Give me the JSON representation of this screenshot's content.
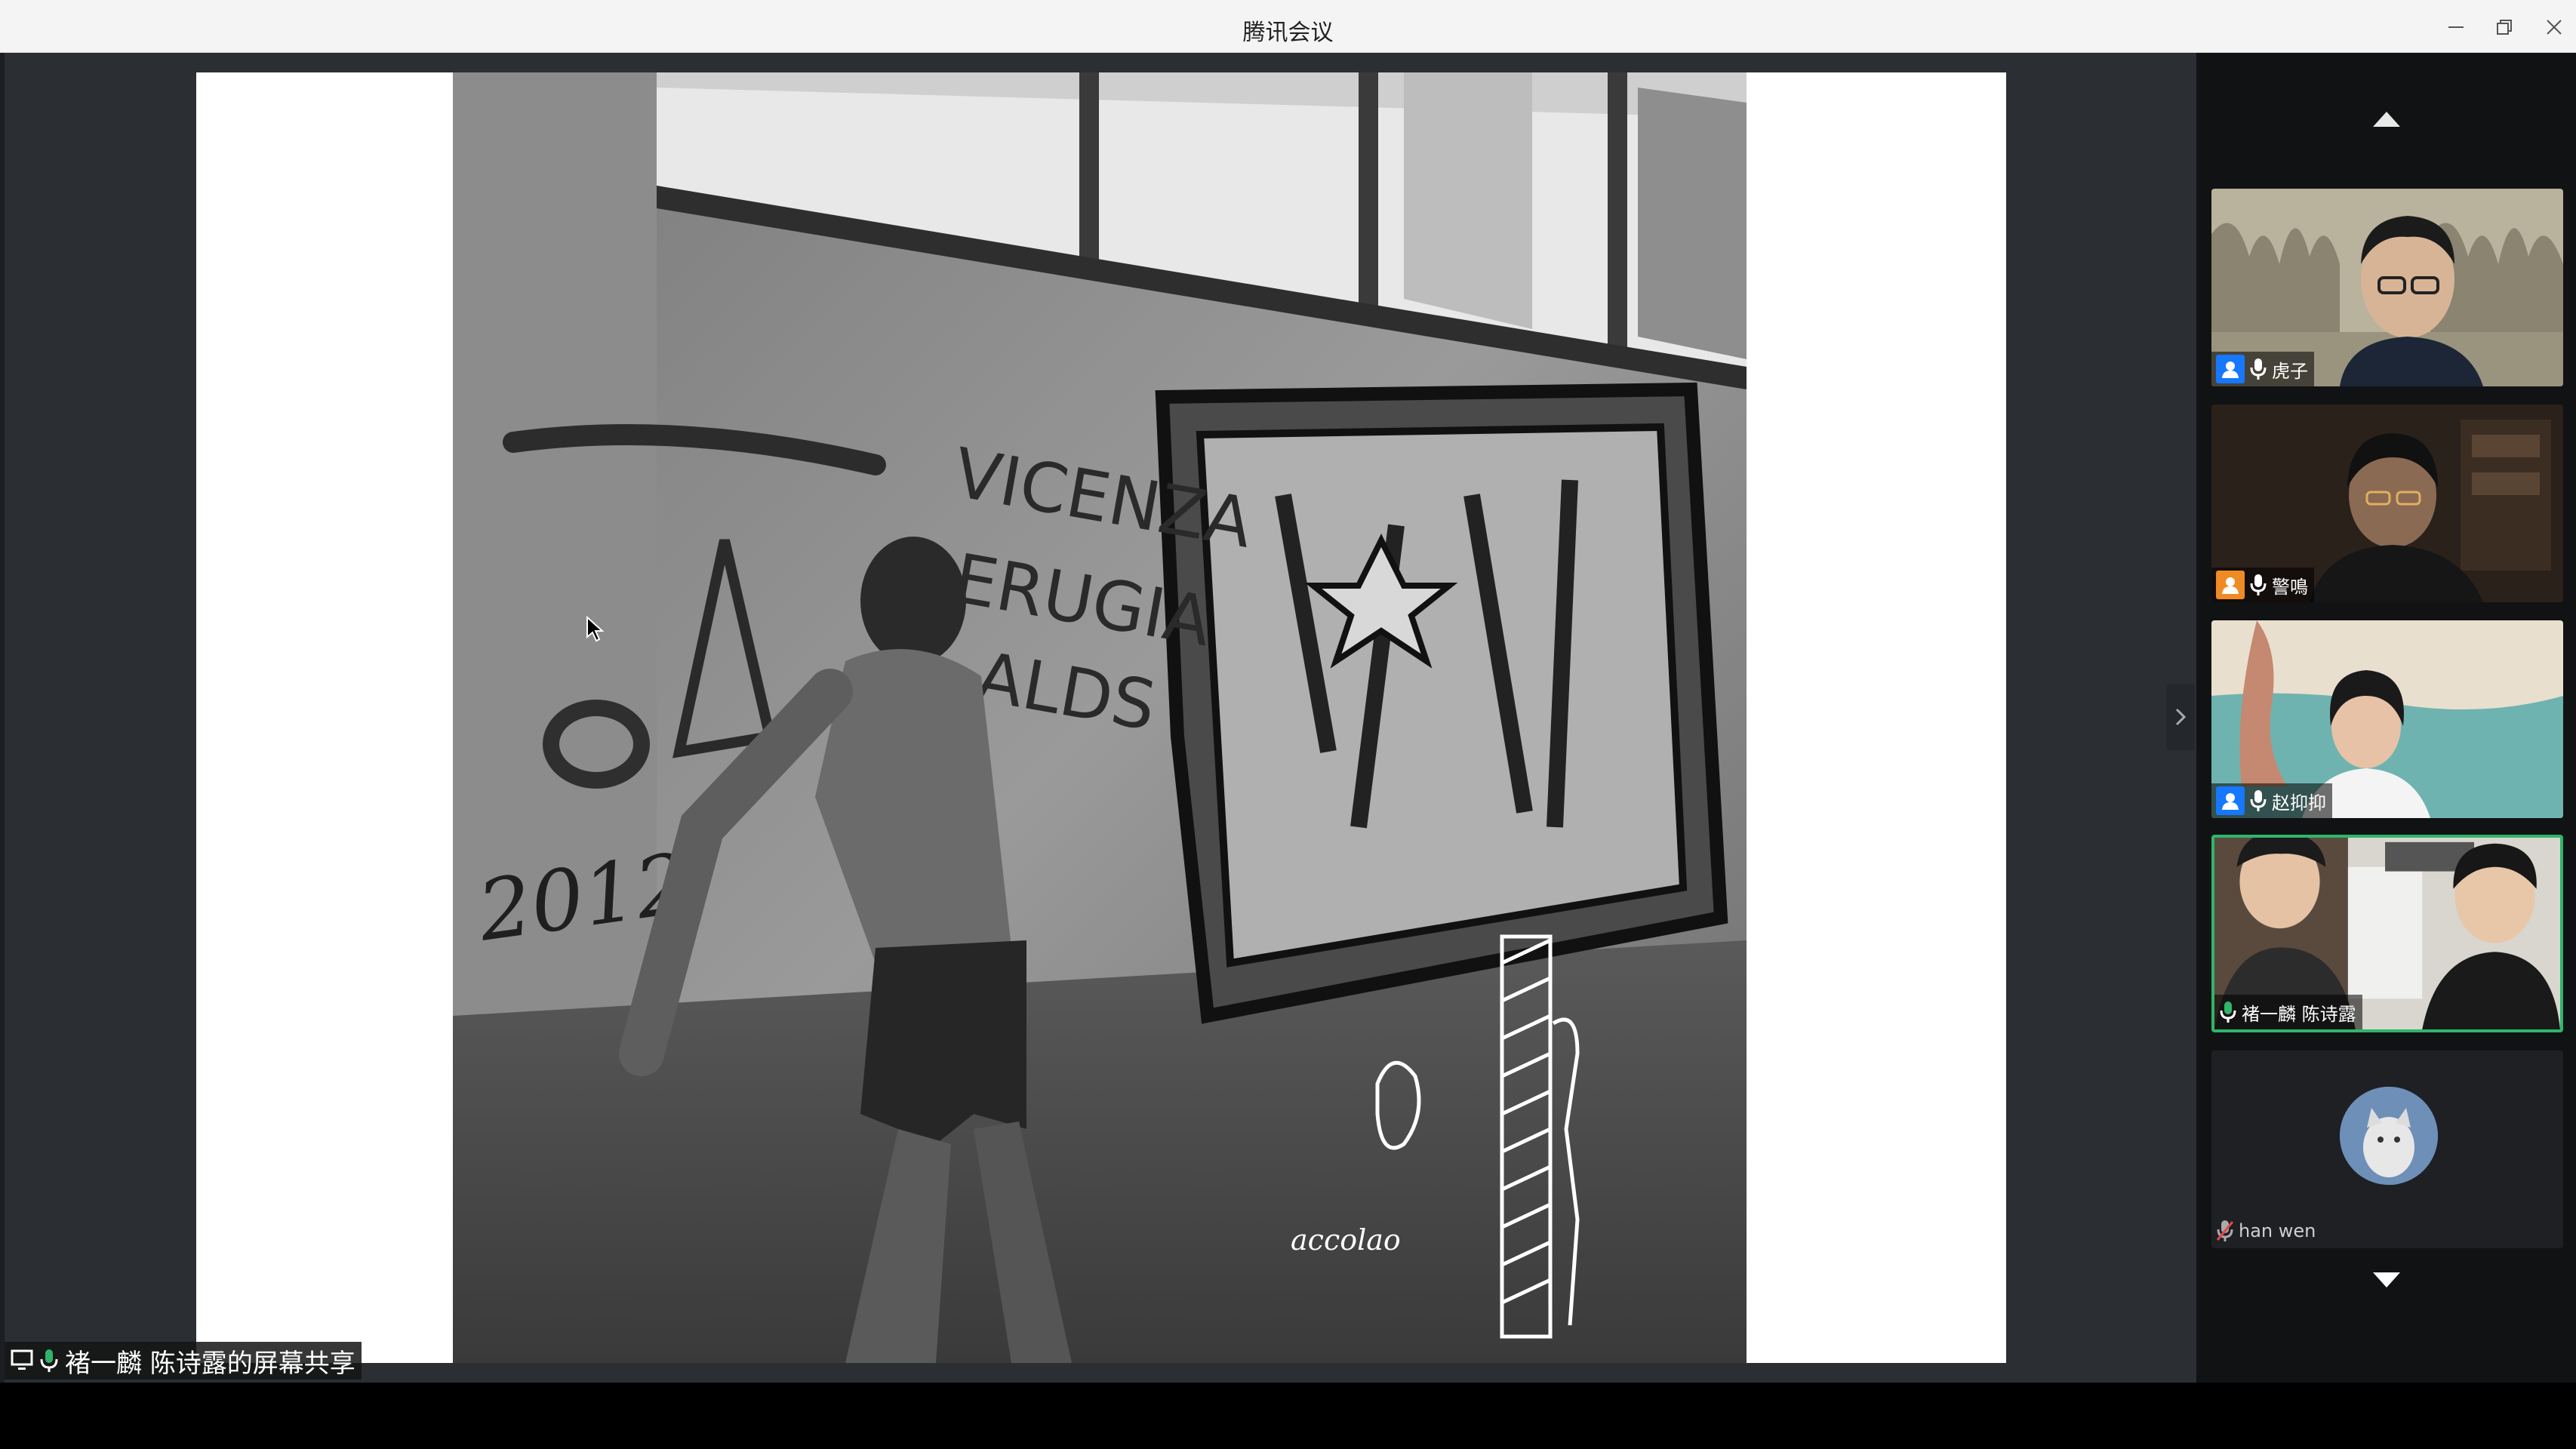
{
  "window": {
    "title": "腾讯会议"
  },
  "share": {
    "label": "褚一麟 陈诗露的屏幕共享",
    "photo_texts": {
      "date_tag": "2012",
      "wall_words": [
        "VICENZA",
        "ERUGIA",
        "ALDS"
      ],
      "sketch_caption": "accolao"
    }
  },
  "participants": [
    {
      "name": "虎子",
      "badge_color": "#1677ff",
      "icon": "person-icon",
      "mic": "mic-icon",
      "video": true
    },
    {
      "name": "警鳴",
      "badge_color": "#f08a24",
      "icon": "person-icon",
      "mic": "mic-icon",
      "video": true
    },
    {
      "name": "赵抑抑",
      "badge_color": "#1677ff",
      "icon": "person-icon",
      "mic": "mic-icon",
      "video": true
    },
    {
      "name": "褚一麟 陈诗露",
      "active_speaker": true,
      "mic": "mic-active-icon",
      "video": true
    },
    {
      "name": "han wen",
      "mic": "mic-muted-icon",
      "video": false
    }
  ],
  "colors": {
    "titlebar": "#f4f4f4",
    "share_bg": "#2b2e33",
    "sidebar_bg": "#111214",
    "active_border": "#2fb56a"
  }
}
